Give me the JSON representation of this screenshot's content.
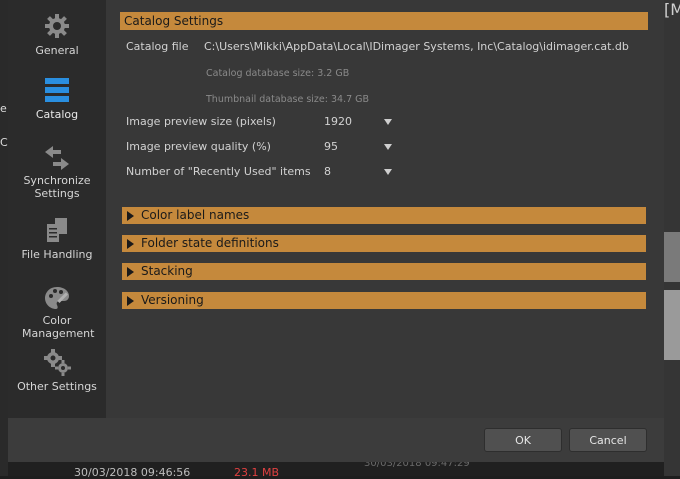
{
  "background": {
    "left_fragments": [
      "e",
      "C"
    ],
    "right_fragment": "[M",
    "bottom_date": "30/03/2018 09:46:56",
    "bottom_badge": "23.1 MB",
    "bottom_date2": "30/03/2018 09:47:29"
  },
  "sidebar": {
    "items": [
      {
        "label": "General",
        "icon": "gear-icon"
      },
      {
        "label": "Catalog",
        "icon": "catalog-icon"
      },
      {
        "label": "Synchronize Settings",
        "icon": "sync-arrows-icon"
      },
      {
        "label": "File Handling",
        "icon": "documents-icon"
      },
      {
        "label": "Color Management",
        "icon": "palette-icon"
      },
      {
        "label": "Other Settings",
        "icon": "gears-icon"
      }
    ]
  },
  "catalog": {
    "header": "Catalog Settings",
    "file_label": "Catalog file",
    "file_path": "C:\\Users\\Mikki\\AppData\\Local\\IDimager Systems, Inc\\Catalog\\idimager.cat.db",
    "db_size": "Catalog database size: 3.2 GB",
    "thumb_size": "Thumbnail database size: 34.7 GB",
    "settings": [
      {
        "label": "Image preview size (pixels)",
        "value": "1920"
      },
      {
        "label": "Image preview quality (%)",
        "value": "95"
      },
      {
        "label": "Number of \"Recently Used\" items",
        "value": "8"
      }
    ],
    "sections": [
      "Color label names",
      "Folder state definitions",
      "Stacking",
      "Versioning"
    ]
  },
  "footer": {
    "ok_label": "OK",
    "cancel_label": "Cancel"
  },
  "colors": {
    "accent": "#c5893c",
    "sidebar_bg": "#2b2b2b",
    "catalog_icon": "#2a8fe0"
  }
}
